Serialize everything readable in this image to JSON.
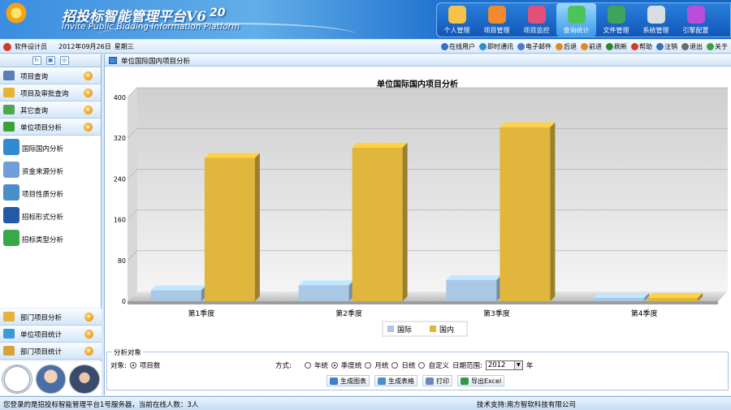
{
  "header": {
    "title": "招投标智能管理平台V6",
    "year": "20",
    "subtitle": "Invite Public Bidding Information Platform"
  },
  "top_nav": [
    {
      "label": "个人管理",
      "icon": "personal-icon",
      "color": "#f6c24a"
    },
    {
      "label": "项目管理",
      "icon": "project-icon",
      "color": "#f08a2c"
    },
    {
      "label": "项目监控",
      "icon": "monitor-icon",
      "color": "#e2507a"
    },
    {
      "label": "查询统计",
      "icon": "query-stats-icon",
      "color": "#4cc35b",
      "active": true
    },
    {
      "label": "文件管理",
      "icon": "file-icon",
      "color": "#3fa35a"
    },
    {
      "label": "系统管理",
      "icon": "system-icon",
      "color": "#d9dde4"
    },
    {
      "label": "引擎配置",
      "icon": "engine-icon",
      "color": "#b84fd8"
    }
  ],
  "toolbar": {
    "user": "软件设计员",
    "date": "2012年09月26日",
    "weekday": "星期三",
    "actions": [
      {
        "label": "在线用户",
        "icon": "online-users-icon",
        "color": "#3b6fc0"
      },
      {
        "label": "即时通讯",
        "icon": "instant-message-icon",
        "color": "#2d8fd0"
      },
      {
        "label": "电子邮件",
        "icon": "email-icon",
        "color": "#4d79c8"
      },
      {
        "label": "后退",
        "icon": "back-icon",
        "color": "#e08a1c"
      },
      {
        "label": "前进",
        "icon": "forward-icon",
        "color": "#e08a1c"
      },
      {
        "label": "刷新",
        "icon": "refresh-icon",
        "color": "#2a8a2a"
      },
      {
        "label": "帮助",
        "icon": "help-icon",
        "color": "#d83a2a"
      },
      {
        "label": "注销",
        "icon": "logout-icon",
        "color": "#3b6fc0"
      },
      {
        "label": "退出",
        "icon": "exit-icon",
        "color": "#6c6c6c"
      },
      {
        "label": "关于",
        "icon": "about-icon",
        "color": "#3aa23a"
      }
    ]
  },
  "sidebar": {
    "groups_top": [
      {
        "label": "项目查询",
        "icon": "project-query-icon",
        "color": "#5b7fb5"
      },
      {
        "label": "项目及审批查询",
        "icon": "approval-query-icon",
        "color": "#e9b432"
      },
      {
        "label": "其它查询",
        "icon": "other-query-icon",
        "color": "#4da84d"
      },
      {
        "label": "单位项目分析",
        "icon": "unit-analysis-icon",
        "color": "#3aa23a",
        "expanded": true
      }
    ],
    "sub_items": [
      {
        "label": "国际国内分析",
        "icon": "intl-domestic-icon",
        "color": "#2f8bd4"
      },
      {
        "label": "资金来源分析",
        "icon": "fund-source-icon",
        "color": "#6f9fd8"
      },
      {
        "label": "项目性质分析",
        "icon": "project-nature-icon",
        "color": "#4a8ec9"
      },
      {
        "label": "招标形式分析",
        "icon": "bidding-form-icon",
        "color": "#2558a8"
      },
      {
        "label": "招标类型分析",
        "icon": "bidding-type-icon",
        "color": "#38a848"
      }
    ],
    "groups_bottom": [
      {
        "label": "部门项目分析",
        "icon": "dept-analysis-icon",
        "color": "#e6b23a"
      },
      {
        "label": "单位项目统计",
        "icon": "unit-stats-icon",
        "color": "#3a9ad8"
      },
      {
        "label": "部门项目统计",
        "icon": "dept-stats-icon",
        "color": "#d8a23a"
      }
    ]
  },
  "panel": {
    "title": "单位国际国内项目分析"
  },
  "chart_data": {
    "type": "bar",
    "title": "单位国际国内项目分析",
    "categories": [
      "第1季度",
      "第2季度",
      "第3季度",
      "第4季度"
    ],
    "series": [
      {
        "name": "国际",
        "values": [
          15,
          25,
          35,
          0
        ],
        "color": "#a9c8e6"
      },
      {
        "name": "国内",
        "values": [
          275,
          295,
          335,
          0
        ],
        "color": "#e0b63c"
      }
    ],
    "ylim": [
      0,
      400
    ],
    "yticks": [
      "0",
      "80",
      "160",
      "240",
      "320",
      "400"
    ],
    "grid": true,
    "legend_position": "bottom"
  },
  "options": {
    "legend": "分析对象",
    "object_label": "对象:",
    "object_value": "项目数",
    "mode_label": "方式:",
    "modes": [
      {
        "label": "年统",
        "checked": false
      },
      {
        "label": "季度统",
        "checked": true
      },
      {
        "label": "月统",
        "checked": false
      },
      {
        "label": "日统",
        "checked": false
      },
      {
        "label": "自定义",
        "checked": false
      }
    ],
    "date_range_label": "日期范围:",
    "year_value": "2012",
    "year_unit": "年",
    "buttons": [
      {
        "label": "生成图表",
        "icon": "chart-icon",
        "color": "#3a7fd0"
      },
      {
        "label": "生成表格",
        "icon": "table-icon",
        "color": "#4a8ec9"
      },
      {
        "label": "打印",
        "icon": "print-icon",
        "color": "#6a8ab8"
      },
      {
        "label": "导出Excel",
        "icon": "excel-icon",
        "color": "#2f9a4a"
      }
    ]
  },
  "footer": {
    "left": "您登录的是招投标智能管理平台1号服务器，当前在线人数：3人",
    "right": "技术支持:南方智软科技有限公司"
  }
}
